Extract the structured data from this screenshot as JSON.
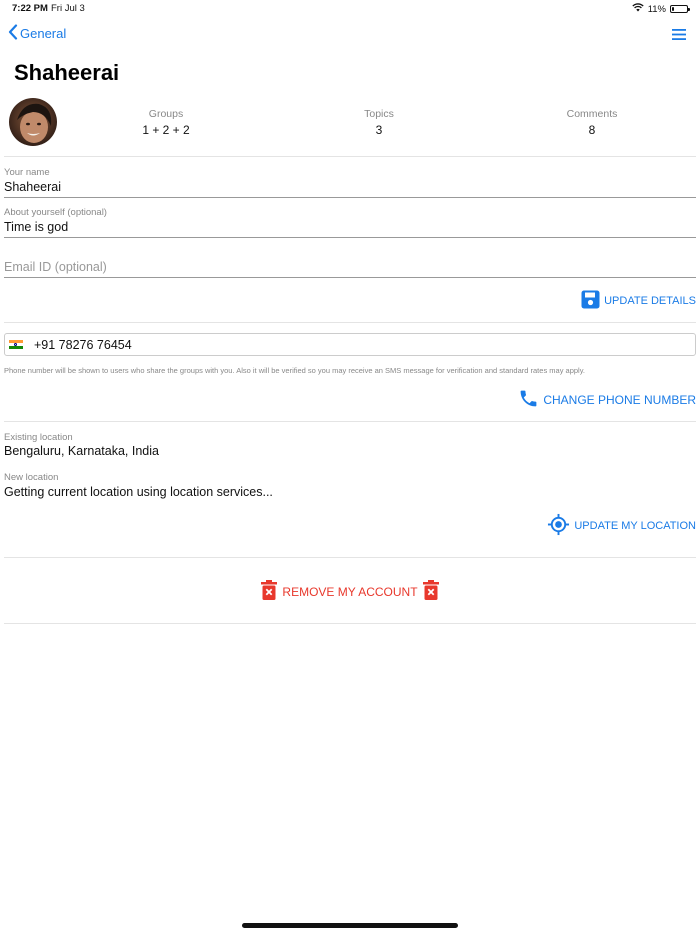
{
  "status_bar": {
    "time": "7:22 PM",
    "date": "Fri Jul 3",
    "battery": "11%",
    "battery_level": 0.11
  },
  "nav": {
    "back_label": "General"
  },
  "page_title": "Shaheerai",
  "stats": [
    {
      "label": "Groups",
      "value": "1 + 2 + 2"
    },
    {
      "label": "Topics",
      "value": "3"
    },
    {
      "label": "Comments",
      "value": "8"
    }
  ],
  "form": {
    "name_label": "Your name",
    "name_value": "Shaheerai",
    "about_label": "About yourself (optional)",
    "about_value": "Time is god",
    "email_placeholder": "Email ID (optional)",
    "update_details": "UPDATE DETAILS"
  },
  "phone": {
    "value": "+91 78276 76454",
    "note": "Phone number will be shown to users who share the groups with you. Also it will be verified so you may receive an SMS message for verification and standard rates may apply.",
    "change_label": "CHANGE PHONE NUMBER"
  },
  "location": {
    "existing_label": "Existing location",
    "existing_value": "Bengaluru, Karnataka, India",
    "new_label": "New location",
    "new_value": "Getting current location using location services...",
    "update_label": "UPDATE MY LOCATION"
  },
  "remove_account": "REMOVE MY ACCOUNT",
  "colors": {
    "accent": "#1a7be6",
    "danger": "#e8382c"
  }
}
